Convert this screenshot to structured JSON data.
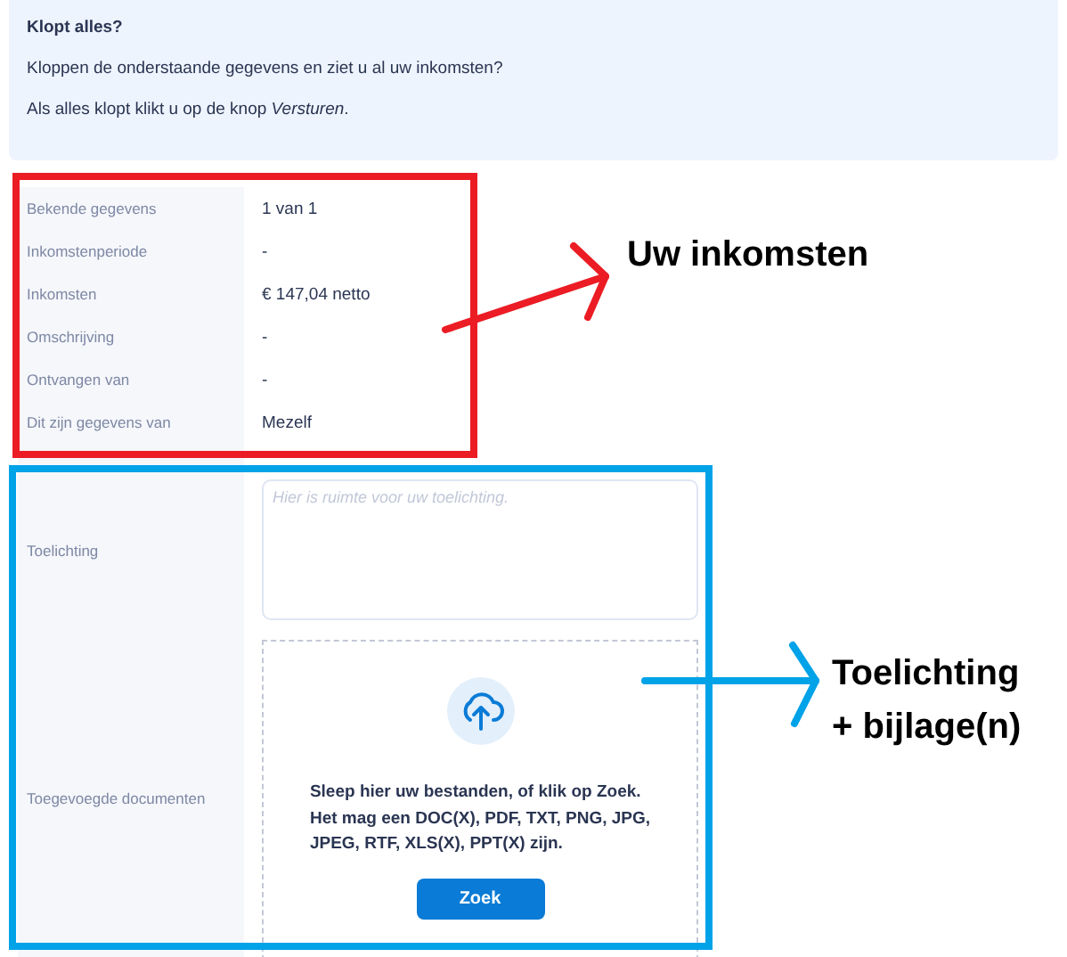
{
  "notice": {
    "title": "Klopt alles?",
    "lines": [
      "Kloppen de onderstaande gegevens en ziet u al uw inkomsten?",
      "Als alles klopt klikt u op de knop *Versturen*."
    ]
  },
  "details": [
    {
      "label": "Bekende gegevens",
      "value": "1 van 1"
    },
    {
      "label": "Inkomstenperiode",
      "value": "-"
    },
    {
      "label": "Inkomsten",
      "value": "€ 147,04 netto"
    },
    {
      "label": "Omschrijving",
      "value": "-"
    },
    {
      "label": "Ontvangen van",
      "value": "-"
    },
    {
      "label": "Dit zijn gegevens van",
      "value": "Mezelf"
    }
  ],
  "explanation": {
    "label": "Toelichting",
    "placeholder": "Hier is ruimte voor uw toelichting."
  },
  "attachments": {
    "label": "Toegevoegde documenten",
    "instructions": [
      "Sleep hier uw bestanden, of klik op Zoek.",
      "Het mag een DOC(X), PDF, TXT, PNG, JPG,",
      "JPEG, RTF, XLS(X), PPT(X) zijn."
    ],
    "button": "Zoek"
  },
  "annotations": [
    {
      "kind": "income",
      "lines": [
        "Uw inkomsten"
      ],
      "color": "#ec1c24"
    },
    {
      "kind": "attachments",
      "lines": [
        "Toelichting",
        "+ bijlage(n)"
      ],
      "color": "#00a2e8"
    }
  ]
}
